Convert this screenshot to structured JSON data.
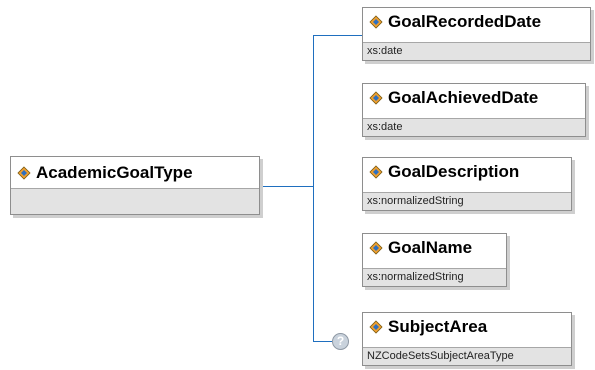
{
  "root": {
    "name": "AcademicGoalType",
    "icon": "element-diamond-icon"
  },
  "children": [
    {
      "name": "GoalRecordedDate",
      "type": "xs:date",
      "optional": false,
      "icon": "element-diamond-icon"
    },
    {
      "name": "GoalAchievedDate",
      "type": "xs:date",
      "optional": false,
      "icon": "element-diamond-icon"
    },
    {
      "name": "GoalDescription",
      "type": "xs:normalizedString",
      "optional": false,
      "icon": "element-diamond-icon"
    },
    {
      "name": "GoalName",
      "type": "xs:normalizedString",
      "optional": false,
      "icon": "element-diamond-icon"
    },
    {
      "name": "SubjectArea",
      "type": "NZCodeSetsSubjectAreaType",
      "optional": true,
      "icon": "element-diamond-icon"
    }
  ],
  "optional_marker": "?",
  "colors": {
    "connector": "#1f6fbf",
    "type_bar": "#e3e3e3",
    "border": "#8e8e8e"
  }
}
